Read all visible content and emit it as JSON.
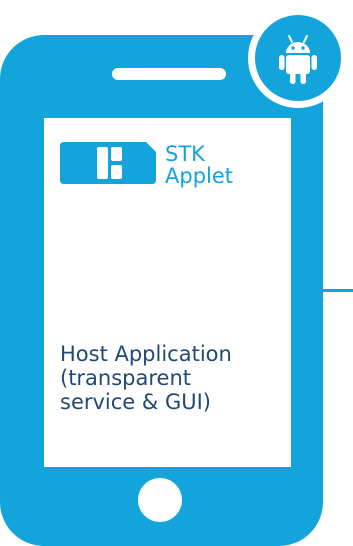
{
  "colors": {
    "accent": "#13a4dc",
    "screen": "#ffffff",
    "host_text": "#1e4a73"
  },
  "icons": {
    "badge": "android-icon",
    "card": "sim-card-icon"
  },
  "stk": {
    "line1": "STK",
    "line2": "Applet"
  },
  "host": {
    "line1": "Host Application",
    "line2": "(transparent",
    "line3": "service & GUI)"
  }
}
